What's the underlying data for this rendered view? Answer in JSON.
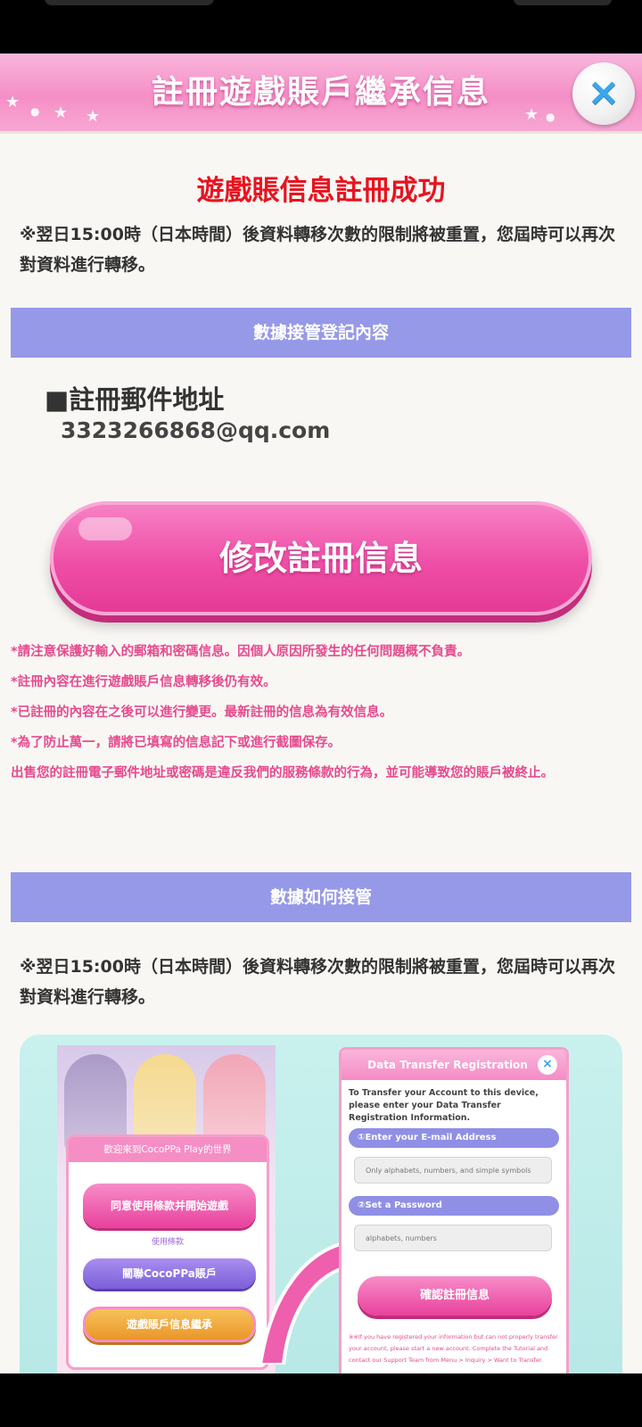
{
  "header": {
    "title": "註冊遊戲賬戶繼承信息",
    "close_icon": "×"
  },
  "success_message": "遊戲賬信息註冊成功",
  "reset_note": "※翌日15:00時（日本時間）後資料轉移次數的限制將被重置，您屆時可以再次對資料進行轉移。",
  "section_registration": {
    "bar_label": "數據接管登記內容",
    "email_label": "■註冊郵件地址",
    "email_value": "3323266868@qq.com",
    "modify_button": "修改註冊信息"
  },
  "warnings": [
    "*請注意保護好輸入的郵箱和密碼信息。因個人原因所發生的任何問題概不負責。",
    "*註冊內容在進行遊戲賬戶信息轉移後仍有效。",
    "*已註冊的內容在之後可以進行變更。最新註冊的信息為有效信息。",
    "*為了防止萬一，請將已填寫的信息記下或進行截圖保存。",
    "出售您的註冊電子郵件地址或密碼是違反我們的服務條款的行為，並可能導致您的賬戶被終止。"
  ],
  "section_howto": {
    "bar_label": "數據如何接管",
    "note": "※翌日15:00時（日本時間）後資料轉移次數的限制將被重置，您屆時可以再次對資料進行轉移。"
  },
  "guide_image": {
    "left_dialog": {
      "title": "歡迎來到CocoPPa Play的世界",
      "agree_button": "同意使用條款并開始遊戲",
      "terms_link": "使用條款",
      "link_button": "關聯CocoPPa賬戶",
      "transfer_button": "遊戲賬戶信息繼承"
    },
    "right_dialog": {
      "title": "Data Transfer Registration",
      "close_icon": "×",
      "intro": "To Transfer your Account to this device, please enter your Data Transfer Registration Information.",
      "step1": "①Enter your E-mail Address",
      "input1_placeholder": "Only alphabets, numbers, and simple symbols",
      "step2": "②Set a Password",
      "input2_placeholder": "alphabets, numbers",
      "confirm_button": "確認註冊信息",
      "note": "※※If you have registered your information but can not properly transfer your account, please start a new account. Complete the Tutorial and contact our Support Team from Menu > Inquiry > Want to Transfer."
    }
  },
  "colors": {
    "header_pink": "#f58fc6",
    "success_red": "#e8131f",
    "bar_purple": "#9699e7",
    "warning_pink": "#e74a8d",
    "button_pink": "#ef4ea6",
    "close_blue": "#3aa7ea"
  }
}
